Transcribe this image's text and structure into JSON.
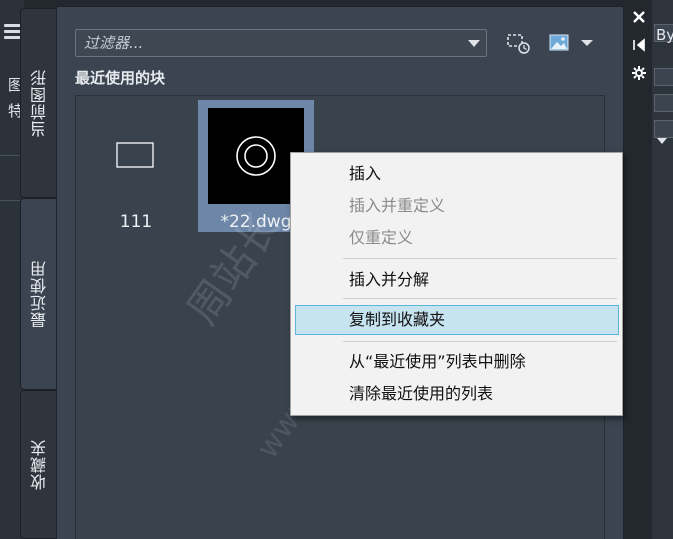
{
  "host": {
    "left_clip_texts": [
      "图",
      "特"
    ],
    "right_clip_text": "ByL"
  },
  "tabs": [
    {
      "label": "当前图形",
      "active": false
    },
    {
      "label": "最近使用",
      "active": true
    },
    {
      "label": "收藏夹",
      "active": false
    }
  ],
  "palette": {
    "filter_placeholder": "过滤器...",
    "section_title": "最近使用的块",
    "blocks": [
      {
        "name": "111",
        "selected": false
      },
      {
        "name": "*22.dwg",
        "selected": true
      }
    ]
  },
  "context_menu": {
    "items": [
      {
        "label": "插入",
        "enabled": true,
        "hover": false
      },
      {
        "label": "插入并重定义",
        "enabled": false,
        "hover": false
      },
      {
        "label": "仅重定义",
        "enabled": false,
        "hover": false
      },
      {
        "label": "插入并分解",
        "enabled": true,
        "hover": false
      },
      {
        "label": "复制到收藏夹",
        "enabled": true,
        "hover": true
      },
      {
        "label": "从“最近使用”列表中删除",
        "enabled": true,
        "hover": false
      },
      {
        "label": "清除最近使用的列表",
        "enabled": true,
        "hover": false
      }
    ]
  },
  "watermark": {
    "line1": "周站长",
    "line2": "www.zzzcp.com"
  },
  "colors": {
    "hover_bg": "#c6e3f0",
    "hover_border": "#5eb3d7",
    "selected_tile": "#6e87a8"
  }
}
